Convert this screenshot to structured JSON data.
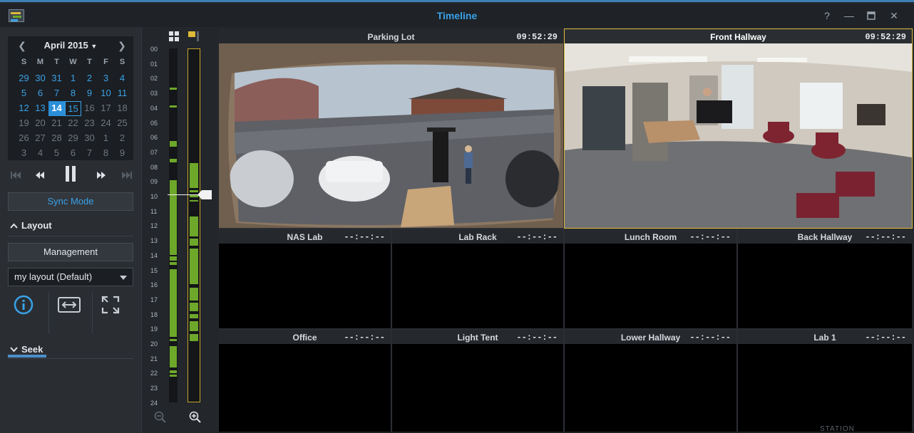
{
  "window": {
    "title": "Timeline"
  },
  "calendar": {
    "month_label": "April 2015",
    "weekdays": [
      "S",
      "M",
      "T",
      "W",
      "T",
      "F",
      "S"
    ],
    "weeks": [
      [
        "29",
        "30",
        "31",
        "1",
        "2",
        "3",
        "4"
      ],
      [
        "5",
        "6",
        "7",
        "8",
        "9",
        "10",
        "11"
      ],
      [
        "12",
        "13",
        "14",
        "15",
        "16",
        "17",
        "18"
      ],
      [
        "19",
        "20",
        "21",
        "22",
        "23",
        "24",
        "25"
      ],
      [
        "26",
        "27",
        "28",
        "29",
        "30",
        "1",
        "2"
      ],
      [
        "3",
        "4",
        "5",
        "6",
        "7",
        "8",
        "9"
      ]
    ],
    "selected_day": "14",
    "today_day": "15"
  },
  "left_panel": {
    "sync_mode_label": "Sync Mode",
    "layout_heading": "Layout",
    "management_label": "Management",
    "layout_select_value": "my layout (Default)",
    "seek_heading": "Seek"
  },
  "timeline": {
    "hours": [
      "00",
      "01",
      "02",
      "03",
      "04",
      "05",
      "06",
      "07",
      "08",
      "09",
      "10",
      "11",
      "12",
      "13",
      "14",
      "15",
      "16",
      "17",
      "18",
      "19",
      "20",
      "21",
      "22",
      "23",
      "24"
    ]
  },
  "cameras": {
    "parking_lot": {
      "name": "Parking Lot",
      "time": "09:52:29"
    },
    "front_hallway": {
      "name": "Front Hallway",
      "time": "09:52:29"
    },
    "nas_lab": {
      "name": "NAS Lab",
      "time": "--:--:--"
    },
    "lab_rack": {
      "name": "Lab Rack",
      "time": "--:--:--"
    },
    "lunch_room": {
      "name": "Lunch Room",
      "time": "--:--:--"
    },
    "back_hallway": {
      "name": "Back Hallway",
      "time": "--:--:--"
    },
    "office": {
      "name": "Office",
      "time": "--:--:--"
    },
    "light_tent": {
      "name": "Light Tent",
      "time": "--:--:--"
    },
    "lower_hallway": {
      "name": "Lower Hallway",
      "time": "--:--:--"
    },
    "lab_1": {
      "name": "Lab 1",
      "time": "--:--:--"
    }
  },
  "brand": {
    "footer": "STATION"
  },
  "colors": {
    "accent": "#39a2e8",
    "recording": "#6ea82a",
    "active_frame": "#e0b93a"
  }
}
